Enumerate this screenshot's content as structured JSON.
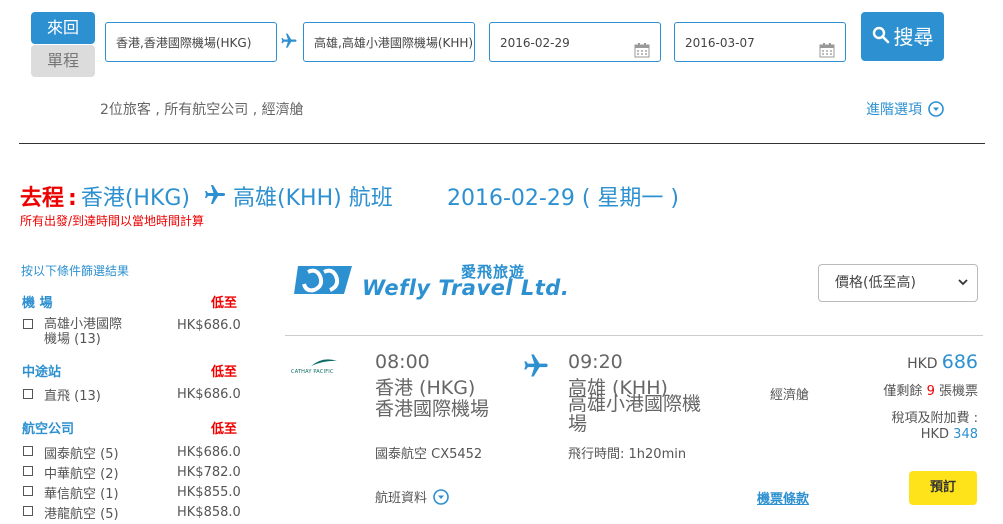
{
  "search": {
    "trip_round": "來回",
    "trip_oneway": "單程",
    "origin": "香港,香港國際機場(HKG)",
    "destination": "高雄,高雄小港國際機場(KHH)",
    "depart_date": "2016-02-29",
    "return_date": "2016-03-07",
    "search_label": "搜尋",
    "summary": "2位旅客 , 所有航空公司 , 經濟艙",
    "advanced": "進階選項"
  },
  "heading": {
    "prefix": "去程",
    "colon": ":",
    "from": "香港(HKG)",
    "to": "高雄(KHH) 航班",
    "date": "2016-02-29 ( 星期一 )",
    "note": "所有出發/到達時間以當地時間計算"
  },
  "filters": {
    "title": "按以下條件篩選結果",
    "lowest_label": "低至",
    "airport": {
      "title": "機 場",
      "items": [
        {
          "label": "高雄小港國際機場 (13)",
          "price": "HK$686.0"
        }
      ]
    },
    "stops": {
      "title": "中途站",
      "items": [
        {
          "label": "直飛 (13)",
          "price": "HK$686.0"
        }
      ]
    },
    "airlines": {
      "title": "航空公司",
      "items": [
        {
          "label": "國泰航空 (5)",
          "price": "HK$686.0"
        },
        {
          "label": "中華航空 (2)",
          "price": "HK$782.0"
        },
        {
          "label": "華信航空 (1)",
          "price": "HK$855.0"
        },
        {
          "label": "港龍航空 (5)",
          "price": "HK$858.0"
        }
      ]
    }
  },
  "brand": {
    "cn": "愛飛旅遊",
    "en": "Wefly Travel Ltd."
  },
  "sort": {
    "selected": "價格(低至高)"
  },
  "result": {
    "airline_logo_text": "CATHAY PACIFIC",
    "dep_time": "08:00",
    "dep_city": "香港 (HKG)",
    "dep_airport": "香港國際機場",
    "arr_time": "09:20",
    "arr_city": "高雄 (KHH)",
    "arr_airport": "高雄小港國際機場",
    "cabin": "經濟艙",
    "flight_no": "國泰航空 CX5452",
    "duration": "飛行時間: 1h20min",
    "currency": "HKD",
    "price": "686",
    "seats_pre": "僅剩餘",
    "seats_num": "9",
    "seats_post": "張機票",
    "tax_label": "稅項及附加費 :",
    "tax_currency": "HKD",
    "tax_value": "348",
    "details_label": "航班資料",
    "fare_rules": "機票條款",
    "book_label": "預訂"
  },
  "colors": {
    "accent": "#2d90d0",
    "red": "#e00000",
    "book": "#ffe31a"
  }
}
